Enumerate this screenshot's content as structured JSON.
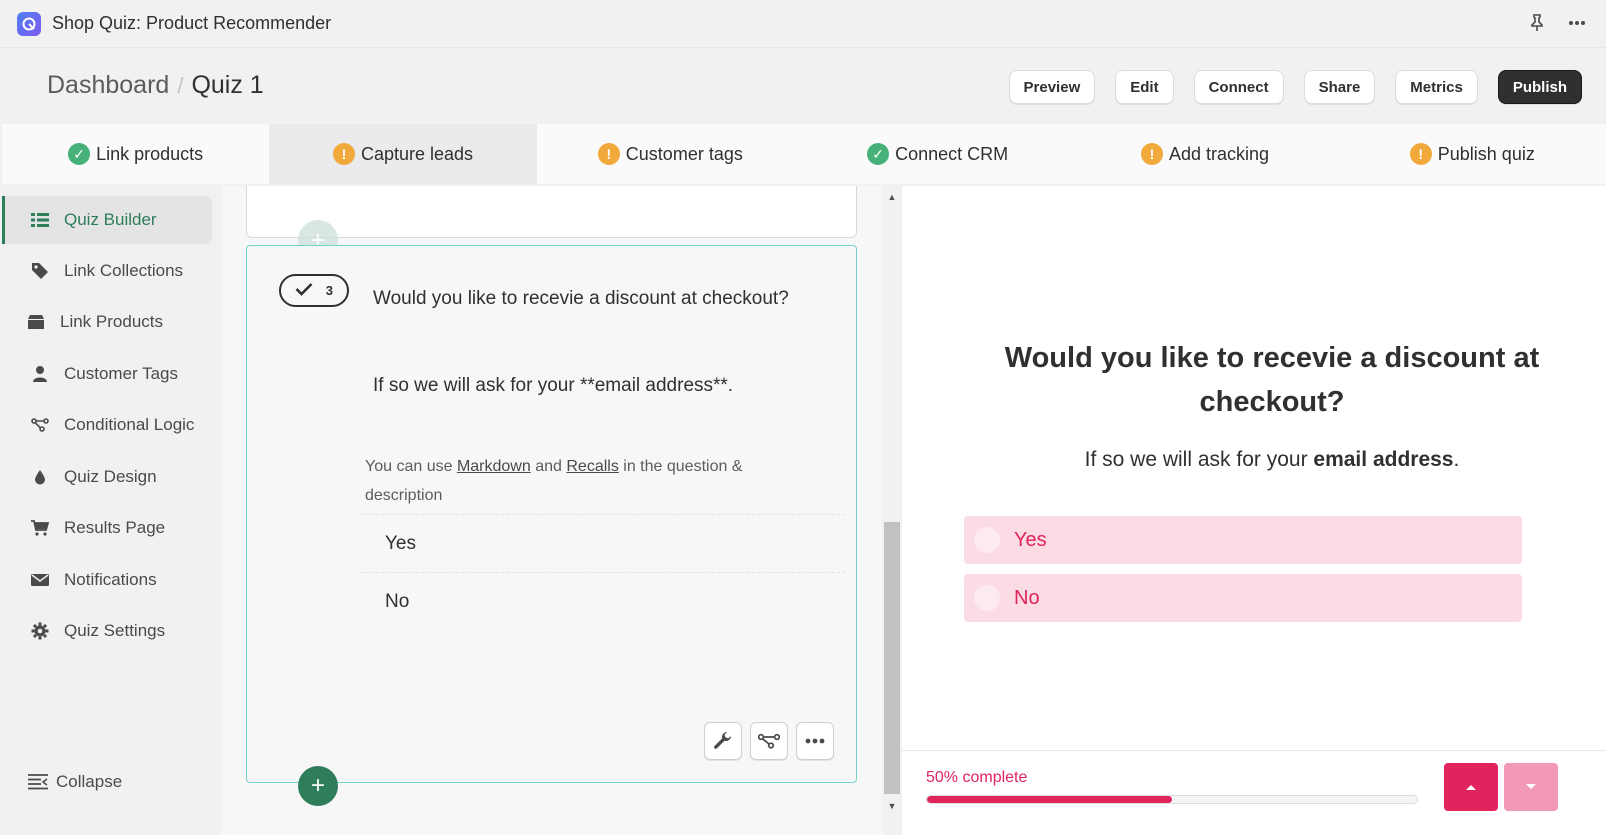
{
  "window": {
    "title": "Shop Quiz: Product Recommender",
    "icons": [
      "pin-icon",
      "more-icon"
    ]
  },
  "breadcrumb": {
    "parent": "Dashboard",
    "separator": "/",
    "current": "Quiz 1"
  },
  "actions": {
    "preview": "Preview",
    "edit": "Edit",
    "connect": "Connect",
    "share": "Share",
    "metrics": "Metrics",
    "publish": "Publish"
  },
  "steps": [
    {
      "label": "Link products",
      "status": "done"
    },
    {
      "label": "Capture leads",
      "status": "warning"
    },
    {
      "label": "Customer tags",
      "status": "warning"
    },
    {
      "label": "Connect CRM",
      "status": "done"
    },
    {
      "label": "Add tracking",
      "status": "warning"
    },
    {
      "label": "Publish quiz",
      "status": "warning"
    }
  ],
  "sidebar": {
    "items": [
      {
        "label": "Quiz Builder",
        "icon": "list-icon"
      },
      {
        "label": "Link Collections",
        "icon": "tag-icon"
      },
      {
        "label": "Link Products",
        "icon": "box-icon"
      },
      {
        "label": "Customer Tags",
        "icon": "user-icon"
      },
      {
        "label": "Conditional Logic",
        "icon": "branch-icon"
      },
      {
        "label": "Quiz Design",
        "icon": "drop-icon"
      },
      {
        "label": "Results Page",
        "icon": "cart-icon"
      },
      {
        "label": "Notifications",
        "icon": "envelope-icon"
      },
      {
        "label": "Quiz Settings",
        "icon": "gear-icon"
      }
    ],
    "active_index": 0,
    "collapse_label": "Collapse"
  },
  "question_card": {
    "number": "3",
    "question": "Would you like to recevie a discount at checkout?",
    "description": "If so we will ask for your **email address**.",
    "hint_prefix": "You can use",
    "hint_markdown": "Markdown",
    "hint_and": "and",
    "hint_recalls": "Recalls",
    "hint_suffix": "in the question & description",
    "answers": [
      "Yes",
      "No"
    ]
  },
  "preview": {
    "question": "Would you like to recevie a discount at checkout?",
    "description_prefix": "If so we will ask for your",
    "description_bold": "email address",
    "description_suffix": ".",
    "options": [
      "Yes",
      "No"
    ],
    "progress_label": "50% complete",
    "progress_value": 0.5
  },
  "colors": {
    "accent_green": "#2e7d5b",
    "accent_pink": "#e0245e",
    "option_bg": "#fbdbe4"
  }
}
